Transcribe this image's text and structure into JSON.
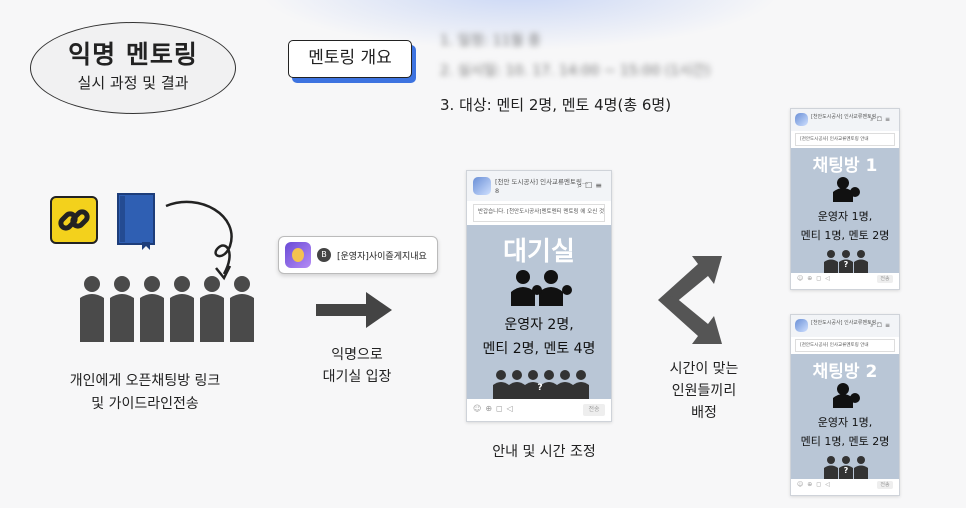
{
  "title": {
    "main": "익명 멘토링",
    "sub": "실시 과정 및 결과"
  },
  "overview": {
    "tag_label": "멘토링 개요",
    "line1": "1. 일정: 11월 중",
    "line2": "2. 실시일: 10. 17. 14:00 ~ 15:00 (1시간)",
    "line3": "3. 대상: 멘티 2명, 멘토 4명(총 6명)"
  },
  "left": {
    "caption_line1": "개인에게 오픈채팅방 링크",
    "caption_line2": "및 가이드라인전송"
  },
  "pill": {
    "badge": "B",
    "text": "[운영자]사이즐게지내요"
  },
  "middle": {
    "caption_line1": "익명으로",
    "caption_line2": "대기실 입장"
  },
  "waiting_room": {
    "header_name": "[천안 도시공사] 인사교류멘토링...",
    "header_count": "8",
    "notice": "반갑습니다. [천안도시공사]멘토멘티 멘토링 에 오신 것을 환영합니다.",
    "title": "대기실",
    "line1": "운영자 2명,",
    "line2": "멘티 2명, 멘토 4명",
    "send_label": "전송",
    "question_mark": "?"
  },
  "waiting_caption": "안내 및 시간 조정",
  "room1": {
    "header_name": "[천안도시공사] 인사교류멘토링...",
    "notice": "[천안도시공사] 인사교류멘토링 안내",
    "title": "채팅방 1",
    "line1": "운영자 1명,",
    "line2": "멘티 1명, 멘토 2명",
    "send_label": "전송",
    "question_mark": "?"
  },
  "room2": {
    "header_name": "[천안도시공사] 인사교류멘토링...",
    "notice": "[천안도시공사] 인사교류멘토링 안내",
    "title": "채팅방 2",
    "line1": "운영자 1명,",
    "line2": "멘티 1명, 멘토 2명",
    "send_label": "전송",
    "question_mark": "?"
  },
  "right_caption": {
    "line1": "시간이 맞는",
    "line2": "인원들끼리",
    "line3": "배정"
  },
  "colors": {
    "accent_blue": "#3d73e0",
    "chat_bg": "#b9c6d6",
    "link_yellow": "#f3d11c",
    "book_blue": "#2f5fb3"
  }
}
